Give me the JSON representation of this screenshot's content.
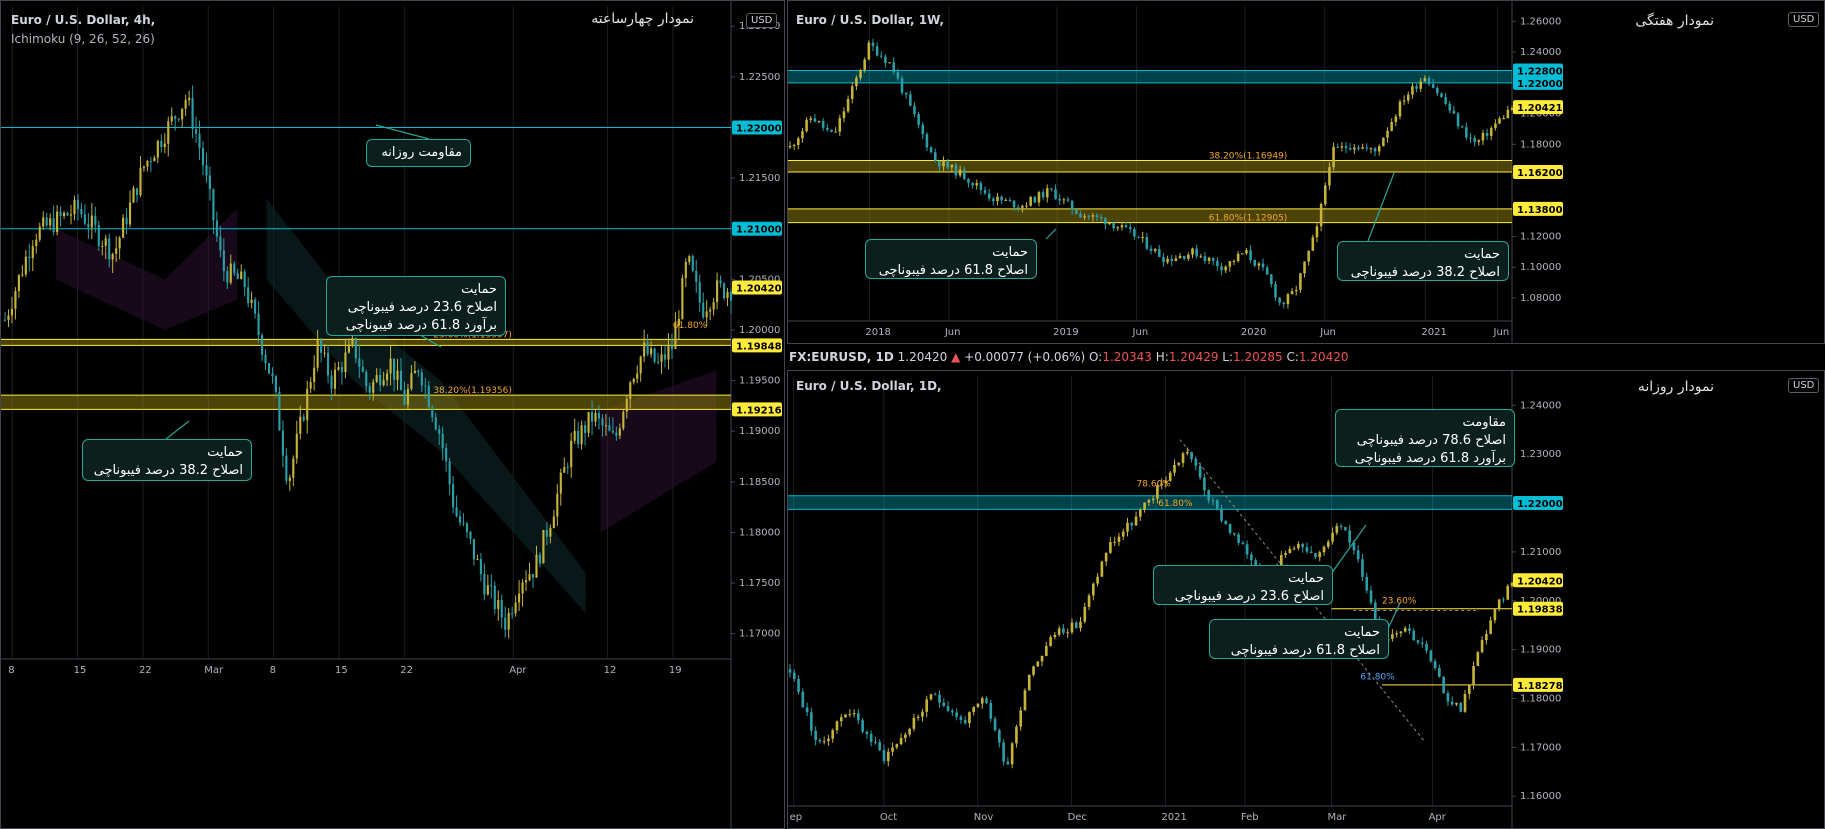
{
  "colors": {
    "bg": "#000000",
    "up": "#c5b33a",
    "down": "#2a9fa8",
    "grid": "#1c1f26",
    "axis": "#b2b5be",
    "res": "#00bcd4",
    "sup": "#ffeb3b",
    "fib": "#f6a623"
  },
  "panel_4h": {
    "symbol": "Euro / U.S. Dollar, 4h,",
    "indicator": "Ichimoku (9, 26, 52, 26)",
    "title_fa": "نمودار چهارساعته",
    "currency": "USD",
    "yticks": [
      "1.23000",
      "1.22500",
      "1.22000",
      "1.21500",
      "1.21000",
      "1.20500",
      "1.20000",
      "1.19500",
      "1.19000",
      "1.18500",
      "1.18000",
      "1.17500",
      "1.17000"
    ],
    "xticks": [
      "8",
      "15",
      "22",
      "Mar",
      "8",
      "15",
      "22",
      "Apr",
      "12",
      "19"
    ],
    "price_labels": [
      {
        "text": "1.22000",
        "kind": "res"
      },
      {
        "text": "1.21000",
        "kind": "res"
      },
      {
        "text": "1.20420",
        "kind": "cur"
      },
      {
        "text": "1.19848",
        "kind": "sup"
      },
      {
        "text": "1.19216",
        "kind": "sup"
      }
    ],
    "fib_labels": [
      "23.60%(1.19907)",
      "38.20%(1.19356)",
      "61.80%"
    ],
    "callouts": [
      {
        "lines": [
          "مقاومت روزانه"
        ]
      },
      {
        "lines": [
          "حمایت",
          "اصلاح 23.6 درصد فیبوناچی",
          "برآورد 61.8 درصد فیبوناچی"
        ]
      },
      {
        "lines": [
          "حمایت",
          "اصلاح 38.2 درصد فیبوناچی"
        ]
      }
    ]
  },
  "panel_1w": {
    "symbol": "Euro / U.S. Dollar, 1W,",
    "title_fa": "نمودار هفتگی",
    "currency": "USD",
    "yticks": [
      "1.26000",
      "1.24000",
      "1.22000",
      "1.20000",
      "1.18000",
      "1.16000",
      "1.14000",
      "1.12000",
      "1.10000",
      "1.08000"
    ],
    "xticks": [
      "2018",
      "Jun",
      "2019",
      "Jun",
      "2020",
      "Jun",
      "2021",
      "Jun"
    ],
    "price_labels": [
      {
        "text": "1.22800",
        "kind": "res"
      },
      {
        "text": "1.22000",
        "kind": "res"
      },
      {
        "text": "1.20421",
        "kind": "cur"
      },
      {
        "text": "1.16200",
        "kind": "sup"
      },
      {
        "text": "1.13800",
        "kind": "sup"
      }
    ],
    "fib_labels": [
      "38.20%(1.16949)",
      "61.80%(1.12905)"
    ],
    "callouts": [
      {
        "lines": [
          "حمایت",
          "اصلاح 61.8 درصد فیبوناچی"
        ]
      },
      {
        "lines": [
          "حمایت",
          "اصلاح 38.2 درصد فیبوناچی"
        ]
      }
    ]
  },
  "ohlc_bar": {
    "symbol": "FX:EURUSD, 1D",
    "last": "1.20420",
    "change": "+0.00077 (+0.06%)",
    "o_label": "O:",
    "o": "1.20343",
    "h_label": "H:",
    "h": "1.20429",
    "l_label": "L:",
    "l": "1.20285",
    "c_label": "C:",
    "c": "1.20420"
  },
  "panel_1d": {
    "symbol": "Euro / U.S. Dollar, 1D,",
    "title_fa": "نمودار روزانه",
    "currency": "USD",
    "yticks": [
      "1.24000",
      "1.23000",
      "1.22000",
      "1.21000",
      "1.20000",
      "1.19000",
      "1.18000",
      "1.17000",
      "1.16000"
    ],
    "xticks": [
      "ep",
      "Oct",
      "Nov",
      "Dec",
      "2021",
      "Feb",
      "Mar",
      "Apr"
    ],
    "price_labels": [
      {
        "text": "1.22000",
        "kind": "res"
      },
      {
        "text": "1.20420",
        "kind": "cur"
      },
      {
        "text": "1.19838",
        "kind": "sup"
      },
      {
        "text": "1.18278",
        "kind": "sup"
      }
    ],
    "fib_labels": [
      "78.60%",
      "61.80%",
      "23.60%",
      "61.80%"
    ],
    "callouts": [
      {
        "lines": [
          "مقاومت",
          "اصلاح 78.6 درصد فیبوناچی",
          "برآورد 61.8 درصد فیبوناچی"
        ]
      },
      {
        "lines": [
          "حمایت",
          "اصلاح 23.6 درصد فیبوناچی"
        ]
      },
      {
        "lines": [
          "حمایت",
          "اصلاح 61.8 درصد فیبوناچی"
        ]
      }
    ]
  },
  "chart_data": [
    {
      "type": "candlestick",
      "timeframe": "4h",
      "title": "Euro / U.S. Dollar, 4h,",
      "ylim": [
        1.1675,
        1.232
      ],
      "close_path": [
        [
          0,
          1.201
        ],
        [
          0.04,
          1.2095
        ],
        [
          0.1,
          1.212
        ],
        [
          0.15,
          1.2075
        ],
        [
          0.19,
          1.216
        ],
        [
          0.25,
          1.223
        ],
        [
          0.27,
          1.2175
        ],
        [
          0.3,
          1.206
        ],
        [
          0.33,
          1.2045
        ],
        [
          0.37,
          1.1945
        ],
        [
          0.39,
          1.185
        ],
        [
          0.41,
          1.1915
        ],
        [
          0.43,
          1.1985
        ],
        [
          0.45,
          1.195
        ],
        [
          0.48,
          1.1985
        ],
        [
          0.5,
          1.194
        ],
        [
          0.53,
          1.197
        ],
        [
          0.55,
          1.193
        ],
        [
          0.57,
          1.1965
        ],
        [
          0.6,
          1.1895
        ],
        [
          0.62,
          1.182
        ],
        [
          0.64,
          1.179
        ],
        [
          0.66,
          1.175
        ],
        [
          0.69,
          1.171
        ],
        [
          0.71,
          1.1755
        ],
        [
          0.73,
          1.1765
        ],
        [
          0.75,
          1.181
        ],
        [
          0.78,
          1.1885
        ],
        [
          0.81,
          1.1915
        ],
        [
          0.84,
          1.189
        ],
        [
          0.86,
          1.195
        ],
        [
          0.88,
          1.198
        ],
        [
          0.9,
          1.1965
        ],
        [
          0.92,
          1.1985
        ],
        [
          0.94,
          1.207
        ],
        [
          0.96,
          1.202
        ],
        [
          0.98,
          1.204
        ]
      ],
      "levels": {
        "resistance": [
          1.22,
          1.21
        ],
        "support": [
          1.19848,
          1.19216
        ],
        "fib_23.6": 1.19907,
        "fib_38.2": 1.19356
      }
    },
    {
      "type": "candlestick",
      "timeframe": "1W",
      "title": "Euro / U.S. Dollar, 1W,",
      "ylim": [
        1.065,
        1.27
      ],
      "close_path": [
        [
          0,
          1.178
        ],
        [
          0.03,
          1.198
        ],
        [
          0.06,
          1.185
        ],
        [
          0.09,
          1.22
        ],
        [
          0.11,
          1.245
        ],
        [
          0.14,
          1.232
        ],
        [
          0.17,
          1.2
        ],
        [
          0.2,
          1.17
        ],
        [
          0.24,
          1.16
        ],
        [
          0.28,
          1.145
        ],
        [
          0.32,
          1.14
        ],
        [
          0.36,
          1.15
        ],
        [
          0.4,
          1.135
        ],
        [
          0.44,
          1.13
        ],
        [
          0.48,
          1.12
        ],
        [
          0.52,
          1.105
        ],
        [
          0.56,
          1.11
        ],
        [
          0.6,
          1.1
        ],
        [
          0.63,
          1.11
        ],
        [
          0.66,
          1.095
        ],
        [
          0.68,
          1.075
        ],
        [
          0.7,
          1.085
        ],
        [
          0.73,
          1.125
        ],
        [
          0.75,
          1.175
        ],
        [
          0.78,
          1.18
        ],
        [
          0.81,
          1.175
        ],
        [
          0.85,
          1.21
        ],
        [
          0.88,
          1.225
        ],
        [
          0.91,
          1.205
        ],
        [
          0.93,
          1.19
        ],
        [
          0.95,
          1.18
        ],
        [
          1.0,
          1.2042
        ]
      ],
      "levels": {
        "resistance": [
          1.228,
          1.22
        ],
        "support": [
          1.162,
          1.138
        ],
        "fib_38.2": 1.16949,
        "fib_61.8": 1.12905
      }
    },
    {
      "type": "candlestick",
      "timeframe": "1D",
      "title": "Euro / U.S. Dollar, 1D,",
      "ylim": [
        1.158,
        1.246
      ],
      "close_path": [
        [
          0,
          1.186
        ],
        [
          0.04,
          1.17
        ],
        [
          0.08,
          1.178
        ],
        [
          0.13,
          1.168
        ],
        [
          0.16,
          1.173
        ],
        [
          0.2,
          1.181
        ],
        [
          0.24,
          1.175
        ],
        [
          0.27,
          1.18
        ],
        [
          0.3,
          1.166
        ],
        [
          0.33,
          1.185
        ],
        [
          0.37,
          1.194
        ],
        [
          0.4,
          1.195
        ],
        [
          0.44,
          1.211
        ],
        [
          0.48,
          1.217
        ],
        [
          0.52,
          1.225
        ],
        [
          0.55,
          1.231
        ],
        [
          0.58,
          1.221
        ],
        [
          0.62,
          1.212
        ],
        [
          0.66,
          1.205
        ],
        [
          0.7,
          1.212
        ],
        [
          0.73,
          1.208
        ],
        [
          0.76,
          1.217
        ],
        [
          0.79,
          1.207
        ],
        [
          0.82,
          1.192
        ],
        [
          0.85,
          1.195
        ],
        [
          0.88,
          1.19
        ],
        [
          0.91,
          1.18
        ],
        [
          0.93,
          1.178
        ],
        [
          0.95,
          1.188
        ],
        [
          0.97,
          1.196
        ],
        [
          1.0,
          1.2042
        ]
      ],
      "levels": {
        "resistance": [
          1.22
        ],
        "support": [
          1.19838,
          1.18278
        ],
        "fib_labels": [
          "78.60%",
          "61.80%",
          "23.60%",
          "61.80%"
        ]
      }
    }
  ]
}
